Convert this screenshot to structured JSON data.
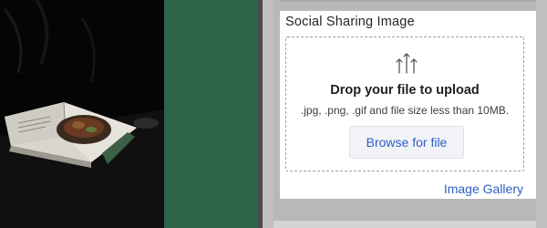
{
  "social_sharing": {
    "title": "Social Sharing Image",
    "dropzone": {
      "icon": "upload-arrows-icon",
      "title": "Drop your file to upload",
      "hint": ".jpg, .png, .gif and file size less than 10MB.",
      "browse_label": "Browse for file"
    },
    "gallery_link": "Image Gallery"
  },
  "colors": {
    "accent": "#2f5ec4",
    "panel_green": "#2e6549"
  }
}
